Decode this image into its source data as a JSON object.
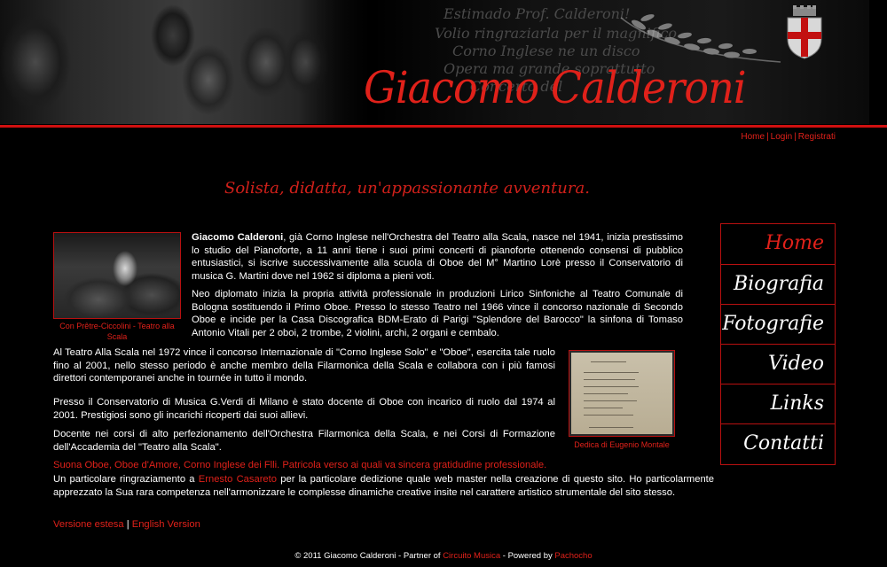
{
  "header": {
    "site_title": "Giacomo Calderoni",
    "letter_lines": [
      "Estimado Prof. Calderoni!",
      "Volio ringraziarla per il magnifico",
      "Corno Inglese ne un disco",
      "Opera ma grande soprattutto",
      "Concerto del"
    ]
  },
  "top_links": {
    "home": "Home",
    "login": "Login",
    "register": "Registrati",
    "sep": "|"
  },
  "tagline": "Solista, didatta, un'appassionante avventura.",
  "nav": {
    "items": [
      {
        "label": "Home",
        "active": true
      },
      {
        "label": "Biografia"
      },
      {
        "label": "Fotografie"
      },
      {
        "label": "Video"
      },
      {
        "label": "Links"
      },
      {
        "label": "Contatti"
      }
    ]
  },
  "content": {
    "name": "Giacomo Calderoni",
    "p1": ", già Corno Inglese nell'Orchestra del Teatro alla Scala, nasce nel 1941, inizia prestissimo lo studio del Pianoforte, a 11 anni tiene i suoi primi concerti di pianoforte ottenendo consensi di pubblico entusiastici, si iscrive successivamente alla scuola di Oboe del M° Martino Lorè presso il Conservatorio di musica G. Martini dove nel 1962 si diploma a pieni voti.",
    "p2": "Neo diplomato inizia la propria attività professionale in produzioni Lirico Sinfoniche al Teatro Comunale di Bologna sostituendo il Primo Oboe. Presso lo stesso Teatro nel 1966 vince il concorso nazionale di Secondo Oboe e incide per la Casa Discografica BDM-Erato di Parigi \"Splendore del Barocco\" la sinfona di Tomaso Antonio Vitali per 2 oboi, 2 trombe, 2 violini, archi, 2 organi e cembalo.",
    "p3": "Al Teatro Alla Scala nel 1972 vince il concorso Internazionale di \"Corno Inglese Solo\" e \"Oboe\", esercita tale ruolo fino al 2001, nello stesso periodo è anche membro della Filarmonica della Scala e collabora con i più famosi direttori contemporanei anche in tournée in tutto il mondo.",
    "p4": "Presso il Conservatorio di Musica G.Verdi di Milano è stato docente di Oboe con incarico di ruolo dal 1974 al 2001. Prestigiosi sono gli incarichi ricoperti dai suoi allievi.",
    "p5": "Docente nei corsi di alto perfezionamento dell'Orchestra Filarmonica della Scala, e nei Corsi di Formazione dell'Accademia del \"Teatro alla Scala\".",
    "red_line": "Suona Oboe, Oboe d'Amore, Corno Inglese dei Flli. Patricola verso ai quali va sincera gratidudine professionale.",
    "thanks_pre": "Un particolare ringraziamento a ",
    "thanks_link": "Ernesto Casareto",
    "thanks_post": " per la particolare dedizione quale web master nella creazione di questo sito. Ho particolarmente apprezzato la Sua rara competenza nell'armonizzare le complesse dinamiche creative insite nel carattere artistico strumentale del sito stesso.",
    "caption1": "Con Prêtre-Ciccolini - Teatro alla Scala",
    "caption2": "Dedica di Eugenio Montale",
    "version_extended": "Versione estesa",
    "version_sep": "|",
    "version_english": "English Version"
  },
  "footer": {
    "pre": "© 2011 Giacomo Calderoni - Partner of ",
    "partner_link": "Circuito Musica",
    "mid": " - Powered by ",
    "powered_link": "Pachocho"
  },
  "colors": {
    "accent": "#e0211a",
    "rule": "#d01010",
    "background": "#000000"
  },
  "icons": {
    "coat_of_arms": "crest-icon",
    "laurel": "laurel-icon"
  }
}
